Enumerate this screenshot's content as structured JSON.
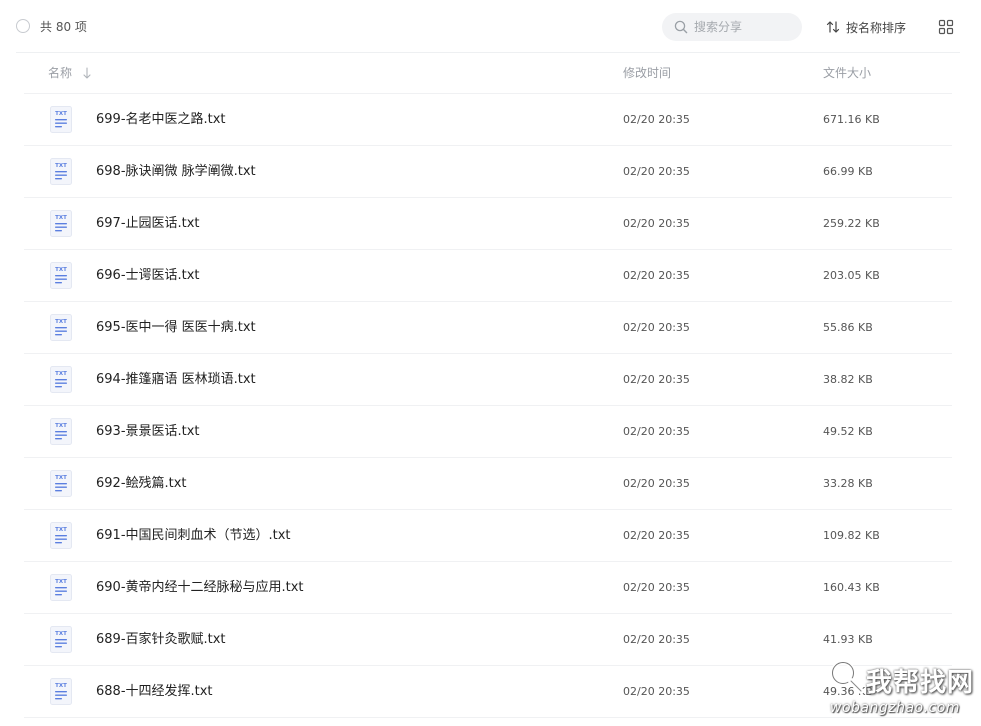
{
  "toolbar": {
    "total_label": "共 80 项",
    "search_placeholder": "搜索分享",
    "sort_label": "按名称排序"
  },
  "columns": {
    "name": "名称",
    "modified": "修改时间",
    "size": "文件大小"
  },
  "files": [
    {
      "name": "699-名老中医之路.txt",
      "modified": "02/20 20:35",
      "size": "671.16 KB",
      "icon_label": "TXT"
    },
    {
      "name": "698-脉诀阐微 脉学阐微.txt",
      "modified": "02/20 20:35",
      "size": "66.99 KB",
      "icon_label": "TXT"
    },
    {
      "name": "697-止园医话.txt",
      "modified": "02/20 20:35",
      "size": "259.22 KB",
      "icon_label": "TXT"
    },
    {
      "name": "696-士谔医话.txt",
      "modified": "02/20 20:35",
      "size": "203.05 KB",
      "icon_label": "TXT"
    },
    {
      "name": "695-医中一得 医医十病.txt",
      "modified": "02/20 20:35",
      "size": "55.86 KB",
      "icon_label": "TXT"
    },
    {
      "name": "694-推篷寤语 医林琐语.txt",
      "modified": "02/20 20:35",
      "size": "38.82 KB",
      "icon_label": "TXT"
    },
    {
      "name": "693-景景医话.txt",
      "modified": "02/20 20:35",
      "size": "49.52 KB",
      "icon_label": "TXT"
    },
    {
      "name": "692-鲙残篇.txt",
      "modified": "02/20 20:35",
      "size": "33.28 KB",
      "icon_label": "TXT"
    },
    {
      "name": "691-中国民间刺血术（节选）.txt",
      "modified": "02/20 20:35",
      "size": "109.82 KB",
      "icon_label": "TXT"
    },
    {
      "name": "690-黄帝内经十二经脉秘与应用.txt",
      "modified": "02/20 20:35",
      "size": "160.43 KB",
      "icon_label": "TXT"
    },
    {
      "name": "689-百家针灸歌赋.txt",
      "modified": "02/20 20:35",
      "size": "41.93 KB",
      "icon_label": "TXT"
    },
    {
      "name": "688-十四经发挥.txt",
      "modified": "02/20 20:35",
      "size": "49.36 KB",
      "icon_label": "TXT"
    }
  ],
  "watermark": {
    "text_cn": "我帮找网",
    "text_en": "wobangzhao.com"
  },
  "colors": {
    "icon_blue": "#5b7fe0",
    "icon_bg": "#f3f5fb",
    "divider": "#f0f1f3",
    "search_bg": "#f2f3f5"
  },
  "icons": {
    "select_all": "circle-checkbox-icon",
    "search": "search-icon",
    "sort": "sort-arrows-icon",
    "view": "grid-view-icon",
    "file": "txt-file-icon"
  }
}
